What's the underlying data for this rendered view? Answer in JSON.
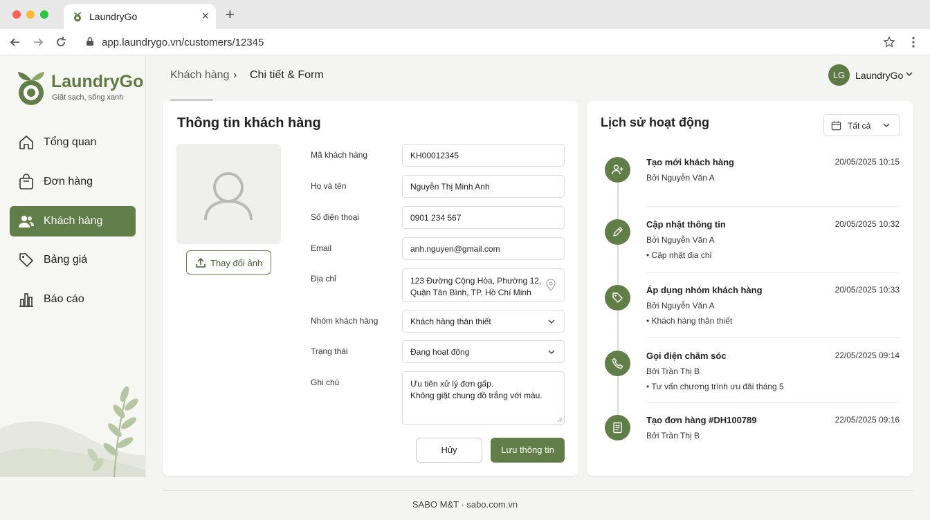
{
  "browser": {
    "tab_title": "LaundryGo",
    "url": "app.laundrygo.vn/customers/12345"
  },
  "sidebar": {
    "brand": "LaundryGo",
    "tagline": "Giặt sạch, sống xanh",
    "items": [
      {
        "label": "Tổng quan",
        "icon": "home-icon"
      },
      {
        "label": "Đơn hàng",
        "icon": "shopping-bag-icon"
      },
      {
        "label": "Khách hàng",
        "icon": "users-icon",
        "active": true
      },
      {
        "label": "Bảng giá",
        "icon": "price-tag-icon"
      },
      {
        "label": "Báo cáo",
        "icon": "bar-chart-icon"
      }
    ]
  },
  "header": {
    "breadcrumb": [
      "Khách hàng",
      "Chi tiết & Form"
    ],
    "user_initials": "LG",
    "user_name": "LaundryGo"
  },
  "customer_form": {
    "title": "Thông tin khách hàng",
    "change_photo": "Thay đổi ảnh",
    "fields": {
      "code": {
        "label": "Mã khách hàng",
        "value": "KH00012345"
      },
      "name": {
        "label": "Họ và tên",
        "value": "Nguyễn Thị Minh Anh"
      },
      "phone": {
        "label": "Số điện thoại",
        "value": "0901 234 567"
      },
      "email": {
        "label": "Email",
        "value": "anh.nguyen@gmail.com"
      },
      "address": {
        "label": "Địa chỉ",
        "value": "123 Đường Cộng Hòa, Phường 12,\nQuận Tân Bình, TP. Hồ Chí Minh"
      },
      "group": {
        "label": "Nhóm khách hàng",
        "value": "Khách hàng thân thiết"
      },
      "status": {
        "label": "Trạng thái",
        "value": "Đang hoạt động"
      },
      "note": {
        "label": "Ghi chú",
        "value": "Ưu tiên xử lý đơn gấp.\nKhông giặt chung đồ trắng với màu."
      }
    },
    "cancel": "Hủy",
    "save": "Lưu thông tin"
  },
  "activity": {
    "title": "Lịch sử hoạt động",
    "filter": "Tất cả",
    "items": [
      {
        "title": "Tạo mới khách hàng",
        "time": "20/05/2025 10:15",
        "by": "Bởi Nguyễn Văn A",
        "note": "",
        "icon": "user-plus-icon"
      },
      {
        "title": "Cập nhật thông tin",
        "time": "20/05/2025 10:32",
        "by": "Bởi Nguyễn Văn A",
        "note": "• Cập nhật địa chỉ",
        "icon": "pencil-icon"
      },
      {
        "title": "Áp dụng nhóm khách hàng",
        "time": "20/05/2025 10:33",
        "by": "Bởi Nguyễn Văn A",
        "note": "• Khách hàng thân thiết",
        "icon": "tag-icon"
      },
      {
        "title": "Gọi điện chăm sóc",
        "time": "22/05/2025 09:14",
        "by": "Bởi Trần Thị B",
        "note": "• Tư vấn chương trình ưu đãi tháng 5",
        "icon": "phone-icon"
      },
      {
        "title": "Tạo đơn hàng #DH100789",
        "time": "22/05/2025 09:16",
        "by": "Bởi Trần Thị B",
        "note": "",
        "icon": "document-icon"
      }
    ]
  },
  "footer": "SABO M&T · sabo.com.vn",
  "colors": {
    "accent": "#627e48",
    "brand": "#5e7a45"
  }
}
